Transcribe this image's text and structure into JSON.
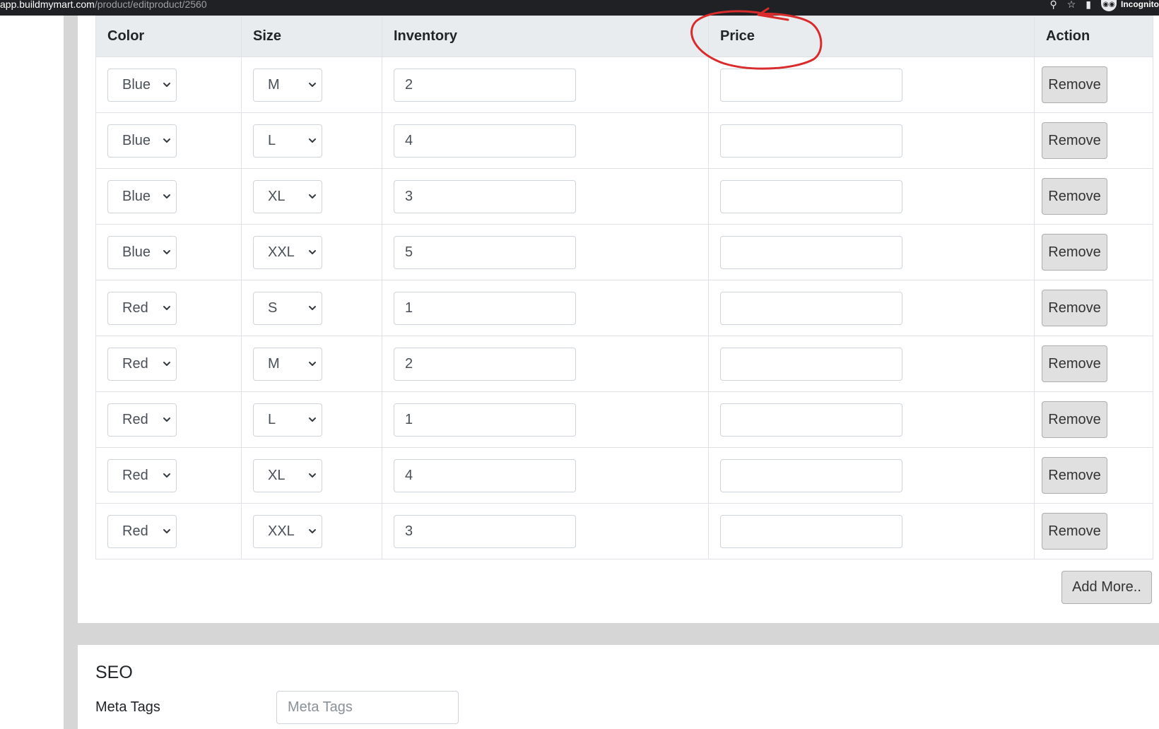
{
  "browser": {
    "url_host": "app.buildmymart.com",
    "url_path": "/product/editproduct/2560",
    "incognito_label": "Incognito"
  },
  "variants": {
    "headers": {
      "color": "Color",
      "size": "Size",
      "inventory": "Inventory",
      "price": "Price",
      "action": "Action"
    },
    "remove_label": "Remove",
    "rows": [
      {
        "color": "Blue",
        "size": "M",
        "inventory": "2",
        "price": ""
      },
      {
        "color": "Blue",
        "size": "L",
        "inventory": "4",
        "price": ""
      },
      {
        "color": "Blue",
        "size": "XL",
        "inventory": "3",
        "price": ""
      },
      {
        "color": "Blue",
        "size": "XXL",
        "inventory": "5",
        "price": ""
      },
      {
        "color": "Red",
        "size": "S",
        "inventory": "1",
        "price": ""
      },
      {
        "color": "Red",
        "size": "M",
        "inventory": "2",
        "price": ""
      },
      {
        "color": "Red",
        "size": "L",
        "inventory": "1",
        "price": ""
      },
      {
        "color": "Red",
        "size": "XL",
        "inventory": "4",
        "price": ""
      },
      {
        "color": "Red",
        "size": "XXL",
        "inventory": "3",
        "price": ""
      }
    ],
    "add_more_label": "Add More.."
  },
  "seo": {
    "title": "SEO",
    "meta_tags_label": "Meta Tags",
    "meta_tags_placeholder": "Meta Tags"
  },
  "colors": {
    "annotation_red": "#d92b2b",
    "header_bg": "#e9ecef",
    "button_bg": "#e0e0e0"
  }
}
